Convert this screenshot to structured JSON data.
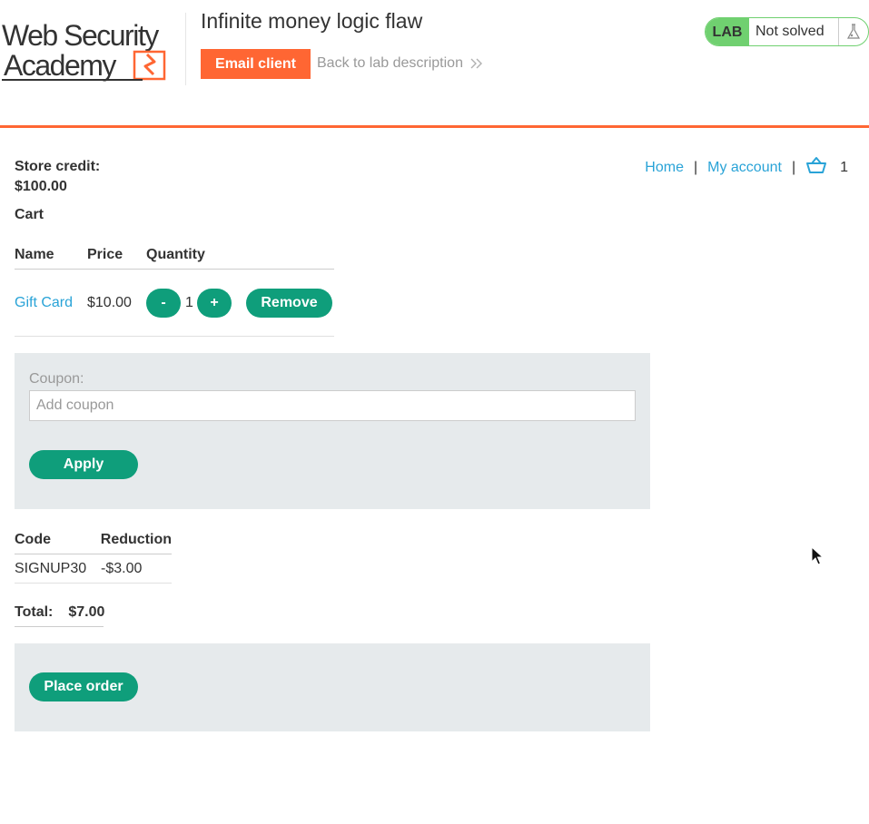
{
  "header": {
    "logo_text": [
      "Web Security",
      "Academy"
    ],
    "lab_title": "Infinite money logic flaw",
    "email_client_label": "Email client",
    "back_link_label": "Back to lab description",
    "lab_badge": {
      "label": "LAB",
      "status": "Not solved",
      "icon": "flask-icon"
    }
  },
  "colors": {
    "accent": "#ff6633",
    "button": "#0f9e7b",
    "link": "#29a3d7",
    "lab_green": "#70d070",
    "panel": "#e6eaec"
  },
  "store": {
    "credit_label": "Store credit:",
    "credit_value": "$100.00",
    "nav": {
      "home": "Home",
      "account": "My account",
      "sep": "|",
      "cart_icon": "basket-icon",
      "cart_count": "1"
    },
    "cart_heading": "Cart"
  },
  "cart": {
    "columns": [
      "Name",
      "Price",
      "Quantity"
    ],
    "items": [
      {
        "name": "Gift Card",
        "price": "$10.00",
        "minus": "-",
        "quantity": "1",
        "plus": "+",
        "remove": "Remove"
      }
    ]
  },
  "coupon": {
    "label": "Coupon:",
    "placeholder": "Add coupon",
    "value": "",
    "apply_label": "Apply"
  },
  "applied_coupons": {
    "columns": [
      "Code",
      "Reduction"
    ],
    "rows": [
      {
        "code": "SIGNUP30",
        "reduction": "-$3.00"
      }
    ]
  },
  "total": {
    "label": "Total:",
    "value": "$7.00"
  },
  "order": {
    "place_label": "Place order"
  }
}
